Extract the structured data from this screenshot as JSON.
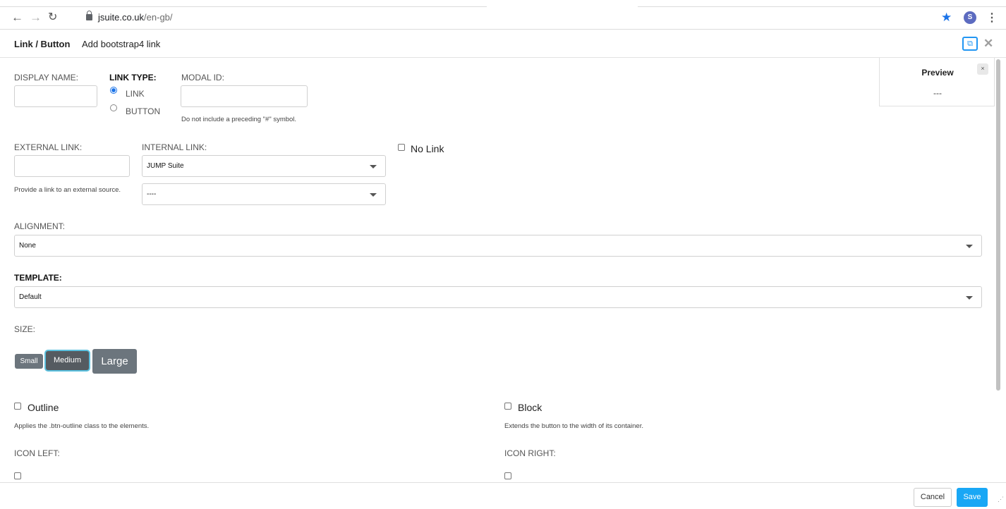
{
  "browser": {
    "url_host": "jsuite.co.uk",
    "url_path": "/en-gb/",
    "avatar_letter": "S"
  },
  "modal": {
    "title": "Link / Button",
    "subtitle": "Add bootstrap4 link"
  },
  "form": {
    "display_name_label": "DISPLAY NAME:",
    "display_name_value": "",
    "link_type_label": "LINK TYPE:",
    "link_type_options": [
      "LINK",
      "BUTTON"
    ],
    "link_type_selected": "LINK",
    "modal_id_label": "MODAL ID:",
    "modal_id_value": "",
    "modal_id_help": "Do not include a preceding \"#\" symbol.",
    "external_link_label": "EXTERNAL LINK:",
    "external_link_value": "",
    "external_link_help": "Provide a link to an external source.",
    "internal_link_label": "INTERNAL LINK:",
    "internal_link_site": "JUMP Suite",
    "internal_link_page": "----",
    "no_link_label": "No Link",
    "alignment_label": "ALIGNMENT:",
    "alignment_value": "None",
    "template_label": "TEMPLATE:",
    "template_value": "Default",
    "size_label": "SIZE:",
    "sizes": [
      "Small",
      "Medium",
      "Large"
    ],
    "size_selected": "Medium",
    "outline_label": "Outline",
    "outline_help": "Applies the .btn-outline class to the elements.",
    "block_label": "Block",
    "block_help": "Extends the button to the width of its container.",
    "icon_left_label": "ICON LEFT:",
    "icon_right_label": "ICON RIGHT:"
  },
  "preview": {
    "title": "Preview",
    "value": "---",
    "close": "×"
  },
  "footer": {
    "cancel": "Cancel",
    "save": "Save"
  },
  "colors": {
    "accent": "#19a7f5",
    "size_button": "#6c757d",
    "focus_ring": "#5bc0de"
  }
}
